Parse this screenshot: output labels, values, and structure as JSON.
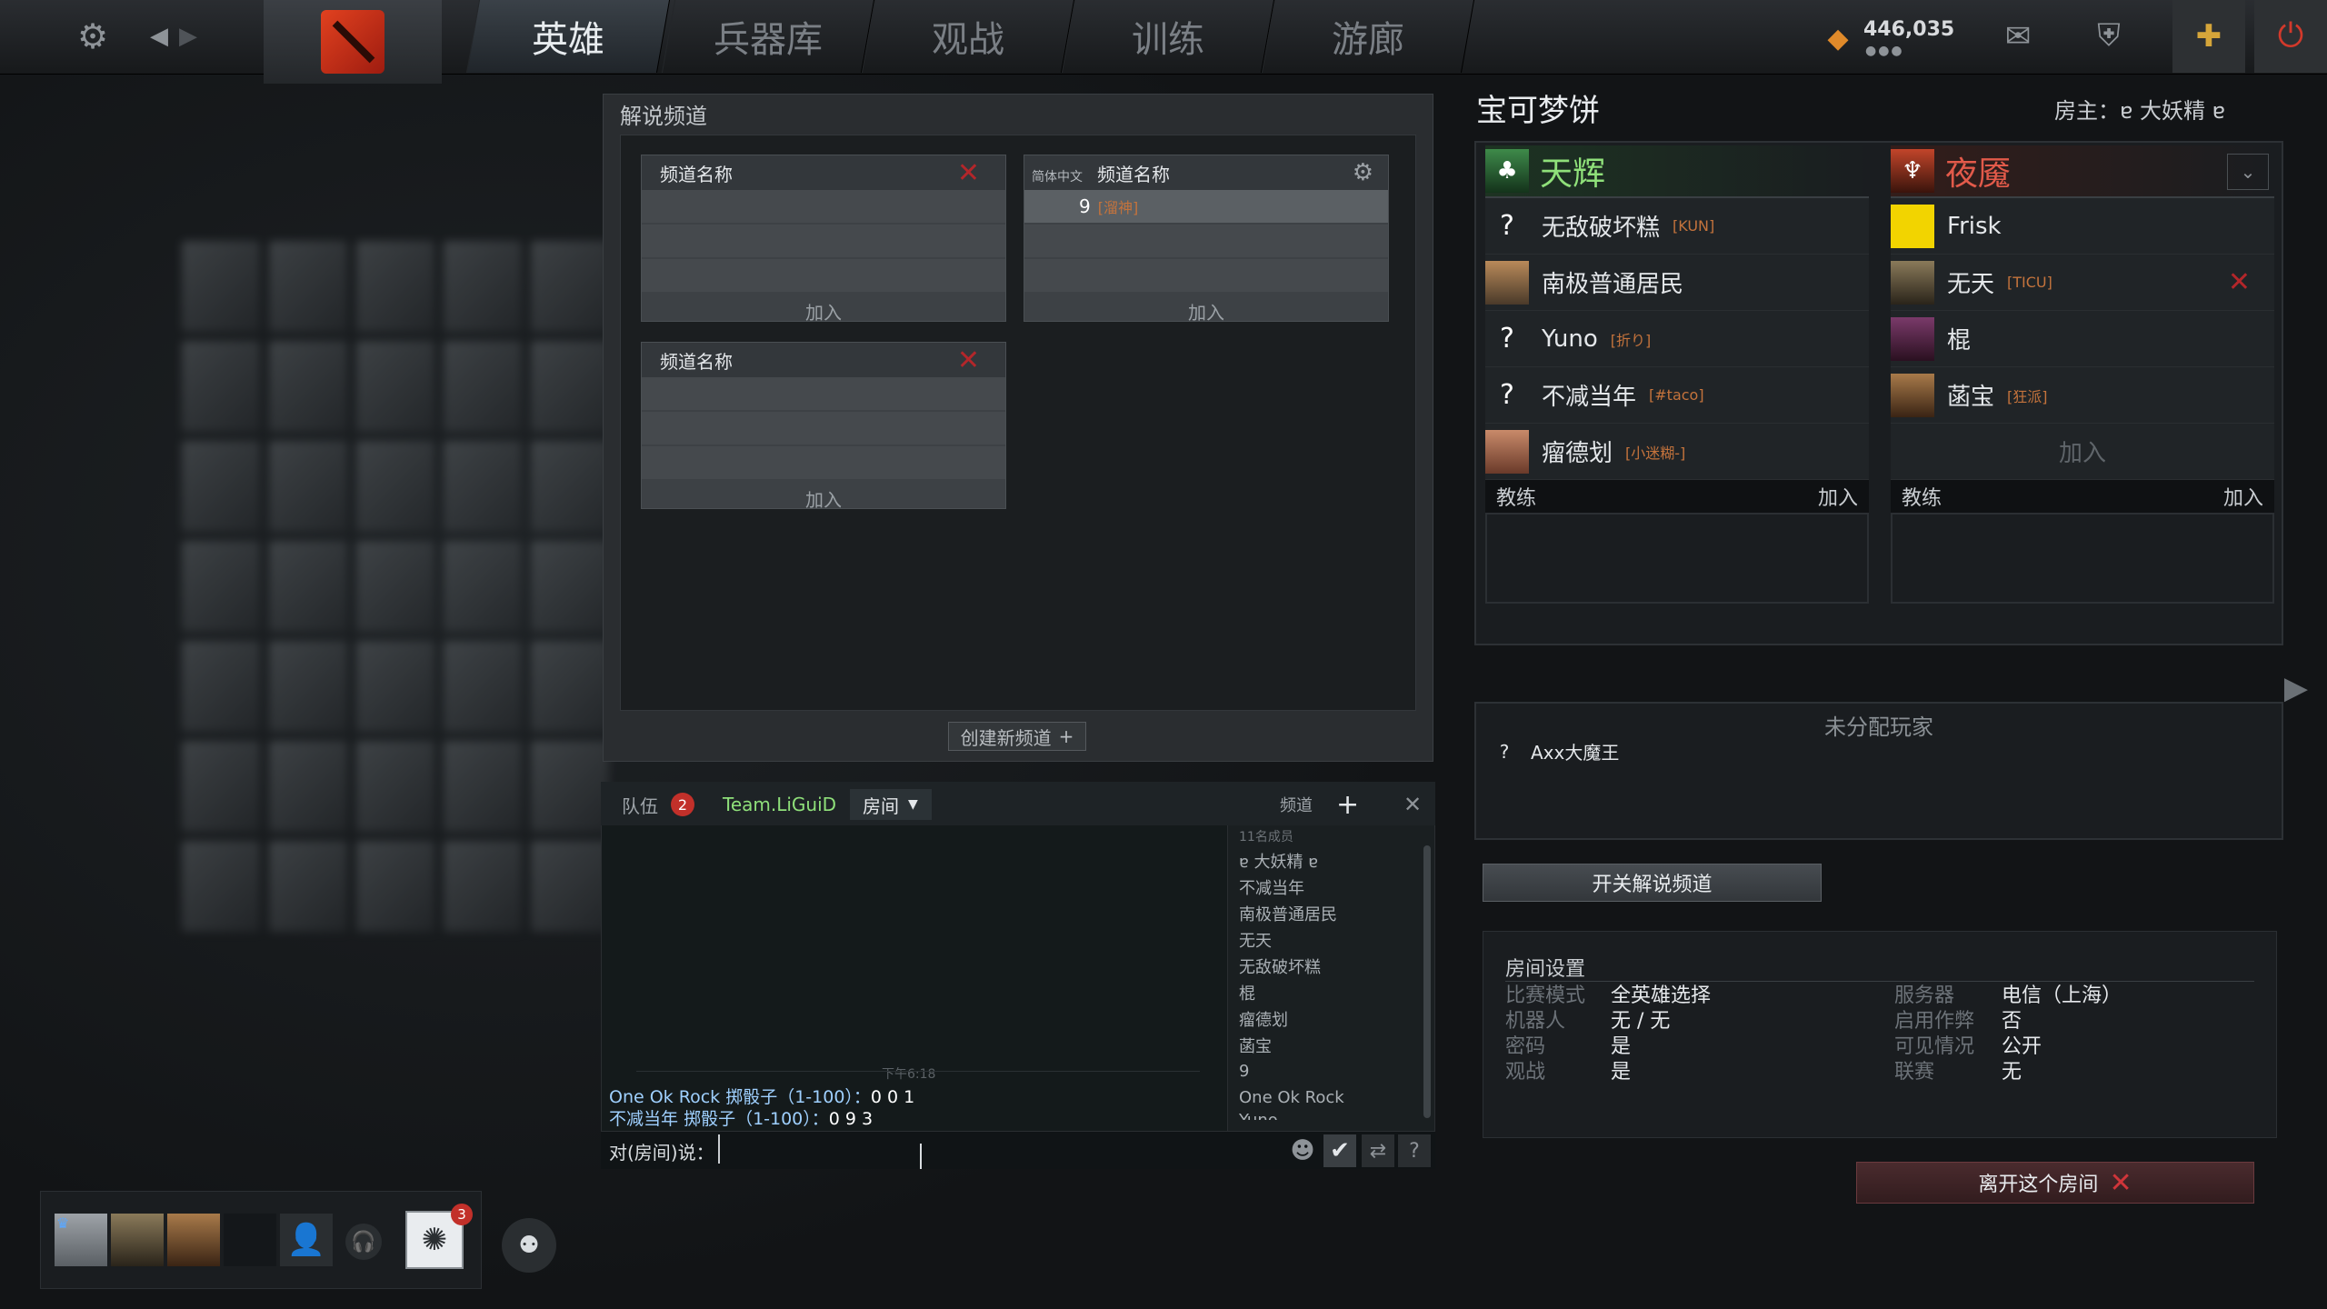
{
  "topnav": {
    "tabs": [
      "英雄",
      "兵器库",
      "观战",
      "训练",
      "游廊"
    ],
    "active_tab": "英雄",
    "currency": "446,035"
  },
  "broadcast": {
    "title": "解说频道",
    "channels": [
      {
        "name": "频道名称",
        "lang": "",
        "members": [],
        "join": "加入"
      },
      {
        "name": "频道名称",
        "lang": "简体中文",
        "members": [
          {
            "n": "9",
            "tag": "[溜神]"
          }
        ],
        "join": "加入"
      },
      {
        "name": "频道名称",
        "lang": "",
        "members": [],
        "join": "加入"
      }
    ],
    "create_label": "创建新频道"
  },
  "chat": {
    "tabs": {
      "team": "队伍",
      "team_count": "2",
      "teamname": "Team.LiGuiD",
      "room": "房间",
      "channel": "频道"
    },
    "timestamp": "下午6:18",
    "messages": [
      {
        "who": "One Ok Rock",
        "text": "掷骰子（1-100）：",
        "val": "0 0 1"
      },
      {
        "who": "不减当年",
        "text": "掷骰子（1-100）：",
        "val": "0 9 3"
      }
    ],
    "input_label": "对(房间)说：",
    "member_count": "11名成员",
    "members": [
      "ɐ 大妖精 ɐ",
      "不减当年",
      "南极普通居民",
      "无天",
      "无敌破坏糕",
      "棍",
      "瘤德划",
      "菡宝",
      "9",
      "One Ok Rock",
      "Yuno"
    ]
  },
  "lobby": {
    "name": "宝可梦饼",
    "host": "房主：ɐ 大妖精 ɐ",
    "radiant": {
      "name": "天辉",
      "players": [
        {
          "name": "无敌破坏糕",
          "tag": "[KUN]",
          "av": "?"
        },
        {
          "name": "南极普通居民",
          "tag": "",
          "av": ""
        },
        {
          "name": "Yuno",
          "tag": "[折り]",
          "av": "?"
        },
        {
          "name": "不减当年",
          "tag": "[#taco]",
          "av": "?"
        },
        {
          "name": "瘤德划",
          "tag": "[小迷糊-]",
          "av": ""
        }
      ]
    },
    "dire": {
      "name": "夜魇",
      "players": [
        {
          "name": "Frisk",
          "tag": "",
          "av": ""
        },
        {
          "name": "无天",
          "tag": "[TICU]",
          "av": ""
        },
        {
          "name": "棍",
          "tag": "",
          "av": ""
        },
        {
          "name": "菡宝",
          "tag": "[狂派]",
          "av": ""
        }
      ],
      "join": "加入"
    },
    "coach": "教练",
    "coach_join": "加入",
    "unassigned_title": "未分配玩家",
    "unassigned": [
      {
        "name": "Axx大魔王",
        "av": "?"
      }
    ],
    "toggle_broadcast": "开关解说频道",
    "settings": {
      "title": "房间设置",
      "left": [
        [
          "比赛模式",
          "全英雄选择"
        ],
        [
          "机器人",
          "无 / 无"
        ],
        [
          "密码",
          "是"
        ],
        [
          "观战",
          "是"
        ]
      ],
      "right": [
        [
          "服务器",
          "电信（上海）"
        ],
        [
          "启用作弊",
          "否"
        ],
        [
          "可见情况",
          "公开"
        ],
        [
          "联赛",
          "无"
        ]
      ]
    },
    "leave": "离开这个房间"
  },
  "party": {
    "team_badge": "3"
  },
  "colors": {
    "radiant": "#8fe07a",
    "dire": "#e25a4a",
    "accent": "#c4733c"
  }
}
